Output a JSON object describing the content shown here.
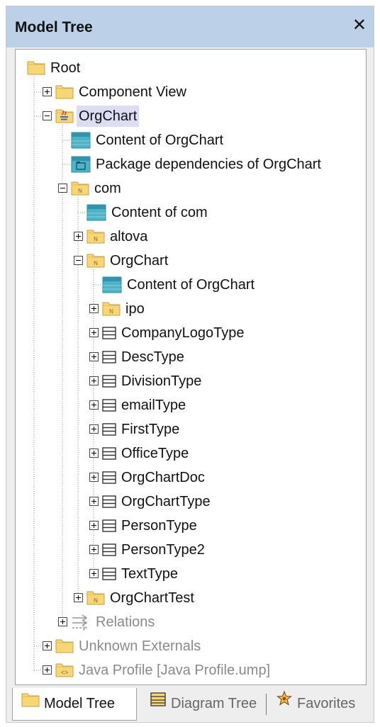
{
  "window": {
    "title": "Model Tree",
    "close_glyph": "✕"
  },
  "tree": [
    {
      "label": "Root",
      "icon": "folder-icon"
    },
    {
      "label": "Component View",
      "icon": "folder-icon",
      "expander": "plus"
    },
    {
      "label": "OrgChart",
      "icon": "java-folder-icon",
      "expander": "minus",
      "selected": true
    },
    {
      "label": "Content of OrgChart",
      "icon": "diagram-content-icon"
    },
    {
      "label": "Package dependencies of OrgChart",
      "icon": "package-diagram-icon"
    },
    {
      "label": "com",
      "icon": "namespace-folder-icon",
      "expander": "minus"
    },
    {
      "label": "Content of com",
      "icon": "diagram-content-icon"
    },
    {
      "label": "altova",
      "icon": "namespace-folder-icon",
      "expander": "plus"
    },
    {
      "label": "OrgChart",
      "icon": "namespace-folder-icon",
      "expander": "minus"
    },
    {
      "label": "Content of OrgChart",
      "icon": "diagram-content-icon"
    },
    {
      "label": "ipo",
      "icon": "namespace-folder-icon",
      "expander": "plus"
    },
    {
      "label": "CompanyLogoType",
      "icon": "class-icon",
      "expander": "plus"
    },
    {
      "label": "DescType",
      "icon": "class-icon",
      "expander": "plus"
    },
    {
      "label": "DivisionType",
      "icon": "class-icon",
      "expander": "plus"
    },
    {
      "label": "emailType",
      "icon": "class-icon",
      "expander": "plus"
    },
    {
      "label": "FirstType",
      "icon": "class-icon",
      "expander": "plus"
    },
    {
      "label": "OfficeType",
      "icon": "class-icon",
      "expander": "plus"
    },
    {
      "label": "OrgChartDoc",
      "icon": "class-icon",
      "expander": "plus"
    },
    {
      "label": "OrgChartType",
      "icon": "class-icon",
      "expander": "plus"
    },
    {
      "label": "PersonType",
      "icon": "class-icon",
      "expander": "plus"
    },
    {
      "label": "PersonType2",
      "icon": "class-icon",
      "expander": "plus"
    },
    {
      "label": "TextType",
      "icon": "class-icon",
      "expander": "plus"
    },
    {
      "label": "OrgChartTest",
      "icon": "namespace-folder-icon",
      "expander": "plus"
    },
    {
      "label": "Relations",
      "icon": "relations-icon",
      "expander": "plus",
      "dim": true
    },
    {
      "label": "Unknown Externals",
      "icon": "folder-icon",
      "expander": "plus",
      "dim": true
    },
    {
      "label": "Java Profile [Java Profile.ump]",
      "icon": "profile-folder-icon",
      "expander": "plus",
      "dim": true
    }
  ],
  "tabs": [
    {
      "label": "Model Tree",
      "icon": "folder-icon",
      "active": true
    },
    {
      "label": "Diagram Tree",
      "icon": "diagram-tree-icon",
      "active": false
    },
    {
      "label": "Favorites",
      "icon": "favorites-icon",
      "active": false
    }
  ],
  "colors": {
    "titlebar": "#bcd0e8",
    "selection": "#dcdcf4",
    "folder": "#f8d676",
    "diagram": "#4fb3c8"
  }
}
